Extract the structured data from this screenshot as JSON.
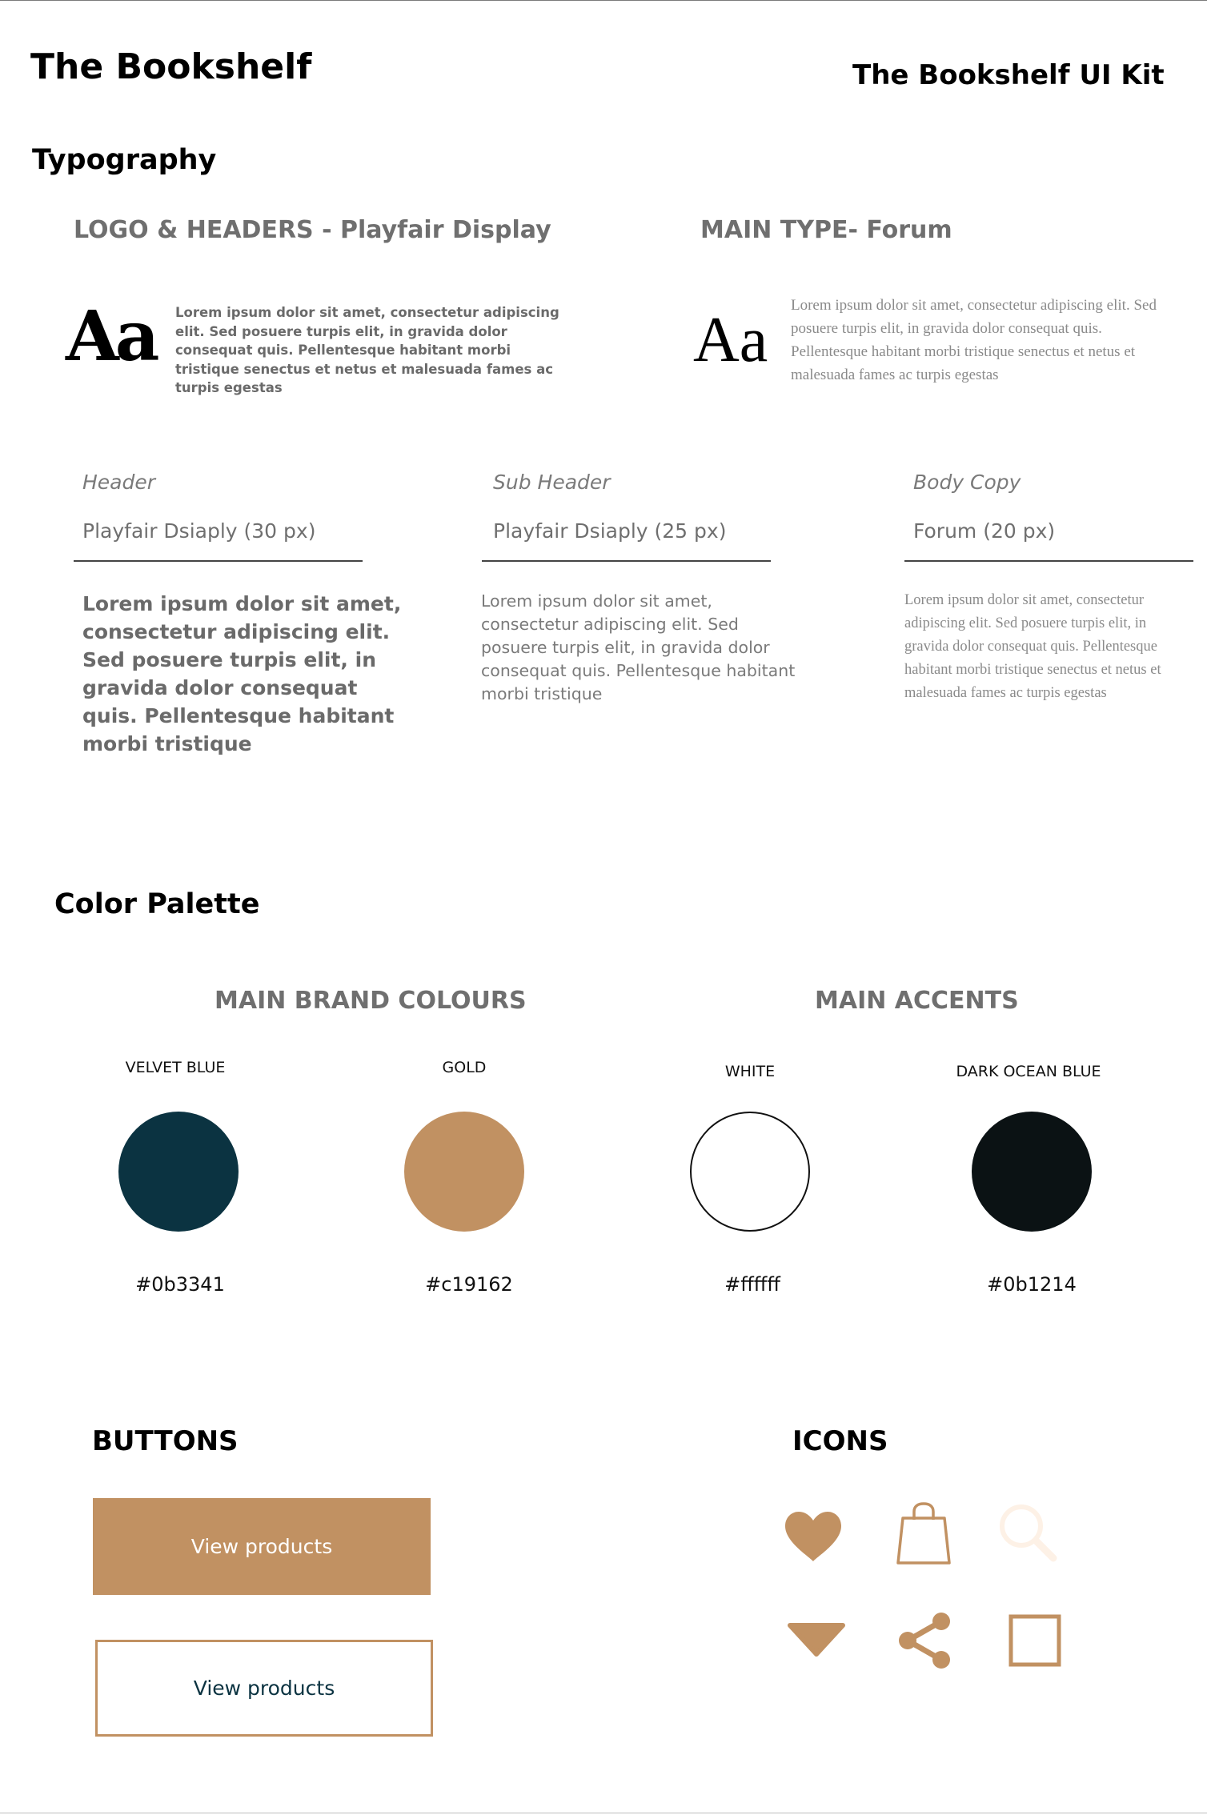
{
  "header": {
    "brand_title": "The Bookshelf",
    "kit_title": "The Bookshelf UI Kit"
  },
  "typography": {
    "section_title": "Typography",
    "logo_headers": {
      "heading": "LOGO & HEADERS - Playfair Display",
      "specimen": "Aa",
      "sample": "Lorem ipsum dolor sit amet, consectetur adipiscing elit. Sed posuere turpis elit, in gravida dolor consequat quis. Pellentesque habitant morbi tristique senectus et netus et malesuada fames ac turpis egestas"
    },
    "main_type": {
      "heading": "MAIN TYPE- Forum",
      "specimen": "Aa",
      "sample": "Lorem ipsum dolor sit amet, consectetur adipiscing elit. Sed posuere turpis elit, in gravida dolor consequat quis. Pellentesque habitant morbi tristique senectus et netus et malesuada fames ac turpis egestas"
    },
    "styles": [
      {
        "label": "Header",
        "size": "Playfair Dsiaply (30 px)",
        "sample": "Lorem ipsum dolor sit amet, consectetur adipiscing elit. Sed posuere turpis elit, in gravida dolor consequat quis. Pellentesque habitant morbi tristique"
      },
      {
        "label": "Sub Header",
        "size": "Playfair Dsiaply (25 px)",
        "sample": "Lorem ipsum dolor sit amet, consectetur adipiscing elit. Sed posuere turpis elit, in gravida dolor consequat quis. Pellentesque habitant morbi tristique"
      },
      {
        "label": "Body Copy",
        "size": "Forum (20 px)",
        "sample": "Lorem ipsum dolor sit amet, consectetur adipiscing elit. Sed posuere turpis elit, in gravida dolor consequat quis. Pellentesque habitant morbi tristique senectus et netus et malesuada fames ac turpis egestas"
      }
    ]
  },
  "palette": {
    "section_title": "Color Palette",
    "brand_heading": "MAIN BRAND COLOURS",
    "accents_heading": "MAIN ACCENTS",
    "swatches": [
      {
        "name": "VELVET BLUE",
        "hex": "#0b3341",
        "color": "#0b3341"
      },
      {
        "name": "GOLD",
        "hex": "#c19162",
        "color": "#c19162"
      },
      {
        "name": "WHITE",
        "hex": "#ffffff",
        "color": "#ffffff"
      },
      {
        "name": "DARK OCEAN BLUE",
        "hex": "#0b1214",
        "color": "#0b1214"
      }
    ]
  },
  "buttons": {
    "section_title": "BUTTONS",
    "primary_label": "View products",
    "secondary_label": "View products"
  },
  "icons": {
    "section_title": "ICONS",
    "items": [
      "heart-icon",
      "shopping-bag-icon",
      "search-icon",
      "caret-down-icon",
      "share-icon",
      "square-icon"
    ],
    "accent_color": "#c19162",
    "faded_color": "#fdf1e6"
  }
}
